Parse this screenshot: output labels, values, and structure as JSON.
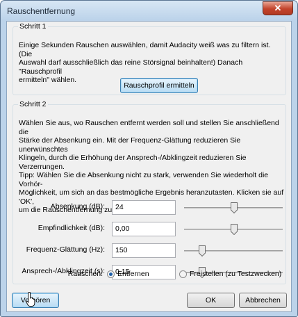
{
  "window": {
    "title": "Rauschentfernung",
    "close_icon": "close-icon"
  },
  "step1": {
    "title": "Schritt 1",
    "description": [
      "Einige Sekunden Rauschen auswählen, damit Audacity weiß was zu filtern ist. (Die",
      "Auswahl darf ausschließlich das reine Störsignal beinhalten!) Danach \"Rauschprofil",
      "ermitteln\" wählen."
    ],
    "button_label": "Rauschprofil ermitteln"
  },
  "step2": {
    "title": "Schritt 2",
    "description": [
      "Wählen Sie aus, wo Rauschen entfernt werden soll und stellen Sie anschließend die",
      "Stärke der Absenkung ein. Mit der Frequenz-Glättung reduzieren Sie unerwünschtes",
      "Klingeln, durch die Erhöhung der Ansprech-/Abklingzeit reduzieren Sie Verzerrungen.",
      "Tipp: Wählen Sie die Absenkung nicht zu stark, verwenden Sie wiederholt die Vorhör-",
      "Möglichkeit, um sich an das bestmögliche Ergebnis heranzutasten. Klicken sie auf 'OK',",
      "um die Rauschentfernung zu starten."
    ],
    "params": [
      {
        "label": "Absenkung (dB):",
        "value": "24",
        "slider_fraction": 0.51
      },
      {
        "label": "Empfindlichkeit (dB):",
        "value": "0,00",
        "slider_fraction": 0.51
      },
      {
        "label": "Frequenz-Glättung (Hz):",
        "value": "150",
        "slider_fraction": 0.18
      },
      {
        "label": "Ansprech-/Abklingzeit (s):",
        "value": "0,15",
        "slider_fraction": 0.18
      }
    ],
    "noise_label": "Rauschen:",
    "radio_options": [
      {
        "label": "Entfernen",
        "selected": true
      },
      {
        "label": "Freistellen (zu Testzwecken)",
        "selected": false
      }
    ]
  },
  "footer": {
    "preview_label": "Vorhören",
    "ok_label": "OK",
    "cancel_label": "Abbrechen"
  },
  "cursor_icon": "pointer-cursor-icon"
}
